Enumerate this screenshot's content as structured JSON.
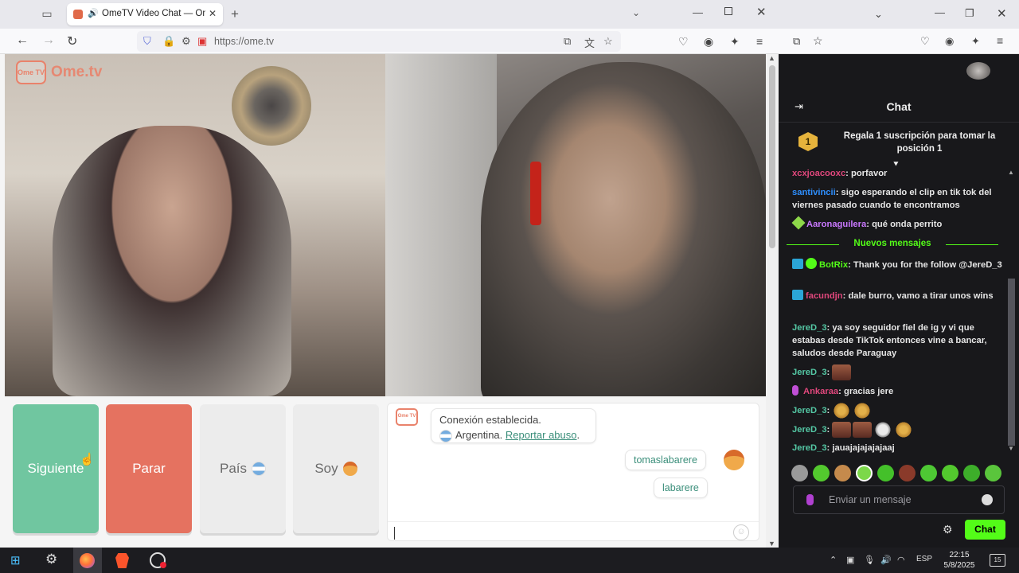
{
  "browser_left": {
    "tab_title": "OmeTV Video Chat — Ome",
    "url": "https://ome.tv"
  },
  "site": {
    "logo_badge": "Ome TV",
    "logo_text": "Ome.tv"
  },
  "controls": {
    "next": "Siguiente",
    "stop": "Parar",
    "country": "País",
    "me": "Soy"
  },
  "chat": {
    "system_line1": "Conexión establecida.",
    "system_country": "Argentina.",
    "report_link": "Reportar abuso",
    "messages": [
      "tomaslabarere",
      "labarere"
    ]
  },
  "stream_chat": {
    "title": "Chat",
    "pinned": "Regala 1 suscripción para tomar la posición 1",
    "pinned_rank": "1",
    "new_messages": "Nuevos mensajes",
    "lines": [
      {
        "user": "xcxjoacooxc",
        "color": "#e0477c",
        "text": ": porfavor"
      },
      {
        "user": "santivincii",
        "color": "#2e8fff",
        "text": ": sigo esperando el clip en tik tok del viernes pasado cuando te encontramos"
      },
      {
        "user": "Aaronaguilera",
        "color": "#c978ff",
        "text": ": qué onda perrito"
      },
      {
        "user": "BotRix",
        "color": "#53fc18",
        "text": ": Thank you for the follow @JereD_3"
      },
      {
        "user": "facundjn",
        "color": "#e0477c",
        "text": ": dale burro, vamo a tirar unos wins"
      },
      {
        "user": "JereD_3",
        "color": "#54c7a4",
        "text": ": ya soy seguidor fiel de ig y vi que estabas desde TikTok entonces vine a bancar, saludos desde Paraguay"
      },
      {
        "user": "JereD_3",
        "color": "#54c7a4",
        "text": ":"
      },
      {
        "user": "Ankaraa",
        "color": "#e0477c",
        "text": ": gracias jere"
      },
      {
        "user": "JereD_3",
        "color": "#54c7a4",
        "text": ":"
      },
      {
        "user": "JereD_3",
        "color": "#54c7a4",
        "text": ":"
      },
      {
        "user": "JereD_3",
        "color": "#54c7a4",
        "text": ": jauajajajajajaaj"
      }
    ],
    "input_placeholder": "Enviar un mensaje",
    "send_label": "Chat"
  },
  "taskbar": {
    "lang": "ESP",
    "time": "22:15",
    "date": "5/8/2025",
    "notifications": "15"
  },
  "colors": {
    "next_button": "#70c6a0",
    "stop_button": "#e57260",
    "kick_green": "#53fc18",
    "brand": "#e9826b"
  },
  "icons": [
    "tab-list-icon",
    "audio-icon",
    "close-icon",
    "plus-icon",
    "back-arrow-icon",
    "forward-arrow-icon",
    "reload-icon",
    "shield-icon",
    "lock-icon",
    "permissions-icon",
    "camera-icon",
    "pip-icon",
    "translate-icon",
    "star-icon",
    "pocket-icon",
    "account-icon",
    "extensions-icon",
    "menu-icon",
    "gear-icon",
    "smile-icon",
    "mic-icon",
    "windows-start-icon",
    "settings-icon",
    "firefox-icon",
    "brave-icon",
    "obs-icon"
  ]
}
